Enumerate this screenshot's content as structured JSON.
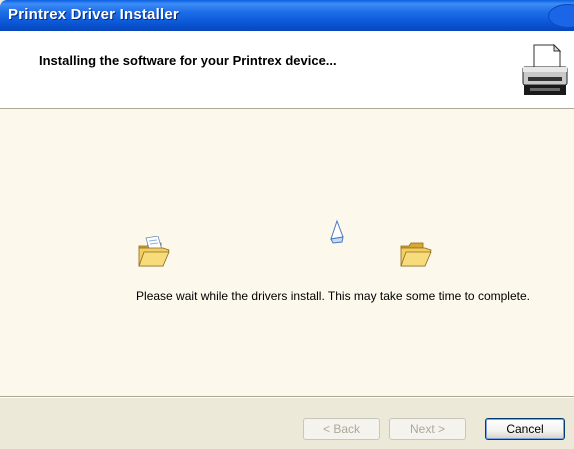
{
  "window": {
    "title": "Printrex Driver Installer"
  },
  "header": {
    "title": "Installing the software for your Printrex device..."
  },
  "main": {
    "message": "Please wait while the drivers install. This may take some time to complete."
  },
  "buttons": {
    "back": "< Back",
    "next": "Next >",
    "cancel": "Cancel"
  },
  "icons": {
    "header": "printer-icon",
    "left": "open-folder-icon",
    "right": "open-folder-icon",
    "animation": "flying-document-icon"
  },
  "colors": {
    "titlebar": "#0a56d6",
    "content_bg": "#fcf8ec",
    "dialog_bg": "#ece9d8"
  }
}
